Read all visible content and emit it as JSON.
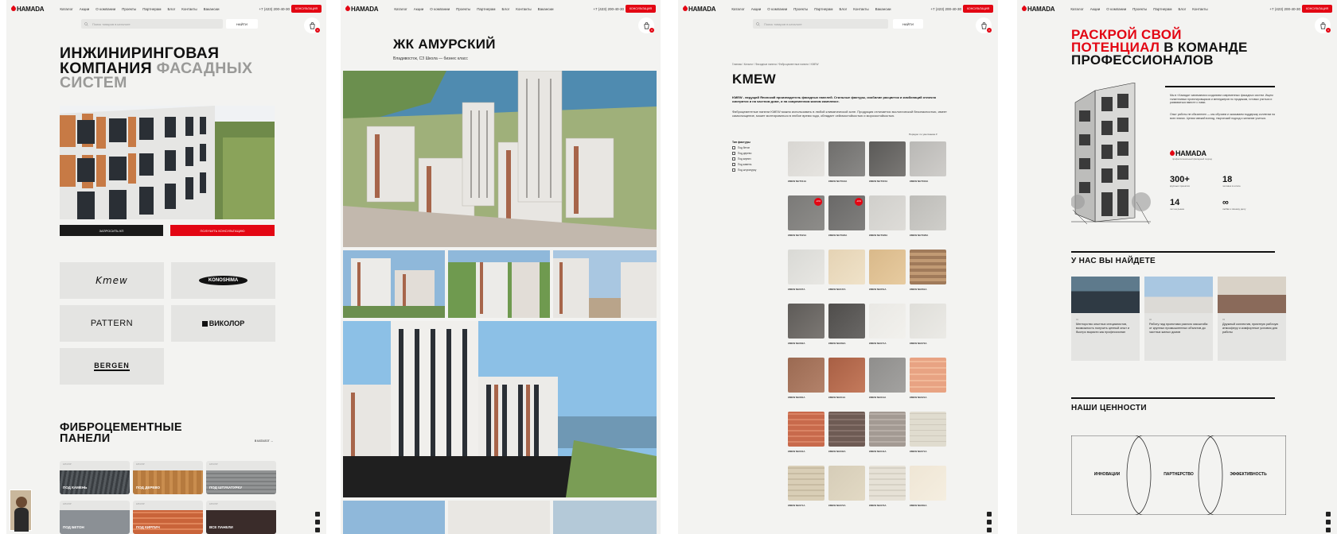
{
  "nav": {
    "logo": "HAMADA",
    "logo_sub": "инжиниринговая компания",
    "links_home": [
      "Каталог",
      "Акции",
      "О компании",
      "Проекты",
      "Партнерам",
      "Блог",
      "Контакты",
      "Вакансии"
    ],
    "links_about": [
      "Каталог",
      "Акции",
      "О компании",
      "Проекты",
      "Партнерам",
      "Блог",
      "Контакты"
    ],
    "phone": "+7 (423) 200-40-30",
    "city": "Владивосток",
    "consult_button": "КОНСУЛЬТАЦИЯ",
    "cart_count": "0"
  },
  "search": {
    "placeholder": "Поиск товаров в каталоге",
    "button": "НАЙТИ"
  },
  "home": {
    "hero_line1": "ИНЖИНИРИНГОВАЯ",
    "hero_line2a": "КОМПАНИЯ ",
    "hero_line2b": "ФАСАДНЫХ",
    "hero_line3": "СИСТЕМ",
    "btn_kp": "ЗАПРОСИТЬ КП",
    "btn_consult": "ПОЛУЧИТЬ КОНСУЛЬТАЦИЮ",
    "brands": [
      "Kmew",
      "KONOSHIMA",
      "PATTERN",
      "ВИКОЛОР",
      "BERGEN"
    ],
    "section_line1": "ФИБРОЦЕМЕНТНЫЕ",
    "section_line2": "ПАНЕЛИ",
    "catalog_link": "В КАТАЛОГ →",
    "category_tag": "КАТАЛОГ",
    "categories": [
      "ПОД КАМЕНЬ",
      "ПОД ДЕРЕВО",
      "ПОД ШТУКАТУРКУ",
      "ПОД БЕТОН",
      "ПОД КИРПИЧ",
      "ВСЕ ПАНЕЛИ"
    ]
  },
  "project": {
    "title": "ЖК АМУРСКИЙ",
    "subtitle": "Владивосток, СЗ Школа — бизнес класс"
  },
  "catalog": {
    "breadcrumb": "Главная / Каталог / Фасадные панели / Фиброцементные панели / KMEW",
    "title": "KMEW",
    "lead": "KMEW - ведущий Японский производитель фасадных панелей. Стильные фактуры, изобилие расцветок и комбинаций отлично смотрятся и на частном доме, и на современном жилом комплексе.",
    "text": "Фиброцементные панели KMEW можно использовать в любой климатической зоне. Продукция отличается экологической безопасностью, имеет самоочищение, может монтироваться в любое время года, обладает сейсмостойкостью и морозостойкостью.",
    "sort": "Порядок: по умолчанию ▾",
    "filter_title": "Тип фактуры",
    "filters": [
      "Под бетон",
      "Под дерево",
      "Под кирпич",
      "Под камень",
      "Под штукатурку"
    ],
    "sale_badge": "-10%",
    "samples": [
      "КМЕW NHT011A",
      "КМЕW NHT013A",
      "КМЕW NHT015A",
      "КМЕW NHT016A",
      "КМЕW NHT021A",
      "КМЕW NHT022A",
      "КМЕW NHT026A",
      "КМЕW NHT026A",
      "КМЕW NH037A",
      "КМЕW NH047A",
      "КМЕW NH051A",
      "КМЕW NH061A",
      "КМЕW NH062A",
      "КМЕW NH063A",
      "КМЕW NH071A",
      "КМЕW NH073A",
      "КМЕW NH081A",
      "КМЕW NH011A",
      "КМЕW NH011A",
      "КМЕW NH021A",
      "КМЕW NH031A",
      "КМЕW NH032A",
      "КМЕW NH041A",
      "КМЕW NH071A",
      "КМЕW NH071A",
      "КМЕW NH072A",
      "КМЕW NH073A",
      "КМЕW NH081A"
    ]
  },
  "careers": {
    "hero_red1": "РАСКРОЙ СВОЙ",
    "hero_red2": "ПОТЕНЦИАЛ",
    "hero_rest2": " В КОМАНДЕ",
    "hero_line3": "ПРОФЕССИОНАЛОВ",
    "intro": "Мы в «Хамада» занимаемся созданием современных фасадных систем. Ищем талантливых проектировщиков и менеджеров по продажам, готовых учиться и развиваться вместе с нами.",
    "intro2": "Опыт работы не обязателен — мы обучаем и оказываем поддержку коллегам на всех этапах. Ценим свежий взгляд, творческий подход и желание учиться.",
    "logo_sub": "профессиональный фасадный подход",
    "stats": [
      {
        "value": "300+",
        "label": "крупных проектов"
      },
      {
        "value": "18",
        "label": "человек в штате"
      },
      {
        "value": "14",
        "label": "лет на рынке"
      },
      {
        "value": "∞",
        "label": "любви к своему делу"
      }
    ],
    "find_title": "У НАС ВЫ НАЙДЕТЕ",
    "find_cards": [
      {
        "tag": "01",
        "text": "Менторство опытных специалистов, возможность получить ценный опыт и быстро вырасти как профессионал"
      },
      {
        "tag": "02",
        "text": "Работу над проектами разного масштаба: от крупных промышленных объектов до частных жилых домов"
      },
      {
        "tag": "03",
        "text": "Дружный коллектив, приятную рабочую атмосферу и комфортные условия для работы"
      }
    ],
    "values_title": "НАШИ ЦЕННОСТИ",
    "values": [
      "ИННОВАЦИИ",
      "ПАРТНЕРСТВО",
      "ЭФФЕКТИВНОСТЬ"
    ]
  },
  "colors": {
    "accent": "#e30613",
    "dark": "#1a1a1a",
    "panel_bg": "#f3f3f1"
  }
}
